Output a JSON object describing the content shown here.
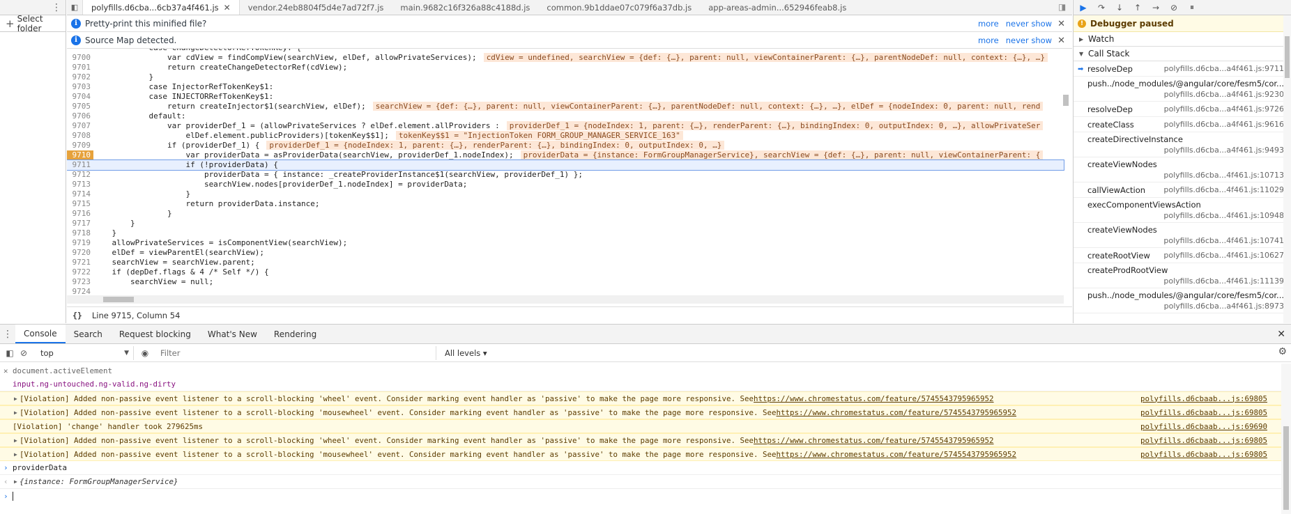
{
  "left_panel": {
    "select_folder_label": "Select folder"
  },
  "file_tabs": [
    {
      "label": "polyfills.d6cba...6cb37a4f461.js",
      "active": true
    },
    {
      "label": "vendor.24eb8804f5d4e7ad72f7.js"
    },
    {
      "label": "main.9682c16f326a88c4188d.js"
    },
    {
      "label": "common.9b1ddae07c079f6a37db.js"
    },
    {
      "label": "app-areas-admin...652946feab8.js"
    }
  ],
  "infobars": {
    "pretty_print": {
      "text": "Pretty-print this minified file?",
      "more": "more",
      "never": "never show"
    },
    "source_map": {
      "text": "Source Map detected.",
      "more": "more",
      "never": "never show"
    }
  },
  "code_lines": [
    {
      "n": "",
      "text": "            case ChangeDetectorRefTokenKey: {",
      "val": ""
    },
    {
      "n": "9700",
      "text": "                var cdView = findCompView(searchView, elDef, allowPrivateServices);",
      "val": "cdView = undefined, searchView = {def: {…}, parent: null, viewContainerParent: {…}, parentNodeDef: null, context: {…}, …}"
    },
    {
      "n": "9701",
      "text": "                return createChangeDetectorRef(cdView);",
      "val": ""
    },
    {
      "n": "9702",
      "text": "            }",
      "val": ""
    },
    {
      "n": "9703",
      "text": "            case InjectorRefTokenKey$1:",
      "val": ""
    },
    {
      "n": "9704",
      "text": "            case INJECTORRefTokenKey$1:",
      "val": ""
    },
    {
      "n": "9705",
      "text": "                return createInjector$1(searchView, elDef);",
      "val": "searchView = {def: {…}, parent: null, viewContainerParent: {…}, parentNodeDef: null, context: {…}, …}, elDef = {nodeIndex: 0, parent: null, rend"
    },
    {
      "n": "9706",
      "text": "            default:",
      "val": ""
    },
    {
      "n": "9707",
      "text": "                var providerDef_1 = (allowPrivateServices ? elDef.element.allProviders :",
      "val": "providerDef_1 = {nodeIndex: 1, parent: {…}, renderParent: {…}, bindingIndex: 0, outputIndex: 0, …}, allowPrivateSer"
    },
    {
      "n": "9708",
      "text": "                    elDef.element.publicProviders)[tokenKey$$1];",
      "val": "tokenKey$$1 = \"InjectionToken FORM_GROUP_MANAGER_SERVICE_163\""
    },
    {
      "n": "9709",
      "text": "                if (providerDef_1) {",
      "val": "providerDef_1 = {nodeIndex: 1, parent: {…}, renderParent: {…}, bindingIndex: 0, outputIndex: 0, …}"
    },
    {
      "n": "9710",
      "text": "                    var providerData = asProviderData(searchView, providerDef_1.nodeIndex);",
      "val": "providerData = {instance: FormGroupManagerService}, searchView = {def: {…}, parent: null, viewContainerParent: {",
      "bp": true
    },
    {
      "n": "9711",
      "text": "                    if (!providerData) {",
      "val": "",
      "current": true
    },
    {
      "n": "9712",
      "text": "                        providerData = { instance: _createProviderInstance$1(searchView, providerDef_1) };",
      "val": ""
    },
    {
      "n": "9713",
      "text": "                        searchView.nodes[providerDef_1.nodeIndex] = providerData;",
      "val": ""
    },
    {
      "n": "9714",
      "text": "                    }",
      "val": ""
    },
    {
      "n": "9715",
      "text": "                    return providerData.instance;",
      "val": ""
    },
    {
      "n": "9716",
      "text": "                }",
      "val": ""
    },
    {
      "n": "9717",
      "text": "        }",
      "val": ""
    },
    {
      "n": "9718",
      "text": "    }",
      "val": ""
    },
    {
      "n": "9719",
      "text": "    allowPrivateServices = isComponentView(searchView);",
      "val": ""
    },
    {
      "n": "9720",
      "text": "    elDef = viewParentEl(searchView);",
      "val": ""
    },
    {
      "n": "9721",
      "text": "    searchView = searchView.parent;",
      "val": ""
    },
    {
      "n": "9722",
      "text": "    if (depDef.flags & 4 /* Self */) {",
      "val": ""
    },
    {
      "n": "9723",
      "text": "        searchView = null;",
      "val": ""
    },
    {
      "n": "9724",
      "text": "",
      "val": ""
    }
  ],
  "status_bar": {
    "braces": "{}",
    "position": "Line 9715, Column 54"
  },
  "debugger": {
    "paused": "Debugger paused",
    "watch": "Watch",
    "call_stack": "Call Stack",
    "frames": [
      {
        "name": "resolveDep",
        "loc": "polyfills.d6cba...a4f461.js:9711",
        "current": true
      },
      {
        "name": "push../node_modules/@angular/core/fesm5/cor...",
        "loc": "polyfills.d6cba...a4f461.js:9230",
        "two": true
      },
      {
        "name": "resolveDep",
        "loc": "polyfills.d6cba...a4f461.js:9726"
      },
      {
        "name": "createClass",
        "loc": "polyfills.d6cba...a4f461.js:9616"
      },
      {
        "name": "createDirectiveInstance",
        "loc": "polyfills.d6cba...a4f461.js:9493",
        "two": true
      },
      {
        "name": "createViewNodes",
        "loc": "polyfills.d6cba...4f461.js:10713",
        "two": true
      },
      {
        "name": "callViewAction",
        "loc": "polyfills.d6cba...4f461.js:11029"
      },
      {
        "name": "execComponentViewsAction",
        "loc": "polyfills.d6cba...4f461.js:10948",
        "two": true
      },
      {
        "name": "createViewNodes",
        "loc": "polyfills.d6cba...4f461.js:10741",
        "two": true
      },
      {
        "name": "createRootView",
        "loc": "polyfills.d6cba...4f461.js:10627"
      },
      {
        "name": "createProdRootView",
        "loc": "polyfills.d6cba...4f461.js:11139",
        "two": true
      },
      {
        "name": "push../node_modules/@angular/core/fesm5/cor...",
        "loc": "polyfills.d6cba...a4f461.js:8973",
        "two": true
      }
    ]
  },
  "drawer": {
    "tabs": [
      "Console",
      "Search",
      "Request blocking",
      "What's New",
      "Rendering"
    ],
    "context": "top",
    "filter_placeholder": "Filter",
    "levels": "All levels ▾"
  },
  "console": {
    "live_expr": "document.activeElement",
    "live_result": "input.ng-untouched.ng-valid.ng-dirty",
    "messages": [
      {
        "text": "[Violation] Added non-passive event listener to a scroll-blocking 'wheel' event. Consider marking event handler as 'passive' to make the page more responsive. See ",
        "link": "https://www.chromestatus.com/feature/5745543795965952",
        "src": "polyfills.d6cbaab...js:69805",
        "tri": true
      },
      {
        "text": "[Violation] Added non-passive event listener to a scroll-blocking 'mousewheel' event. Consider marking event handler as 'passive' to make the page more responsive. See ",
        "link": "https://www.chromestatus.com/feature/5745543795965952",
        "src": "polyfills.d6cbaab...js:69805",
        "tri": true
      },
      {
        "text": "[Violation] 'change' handler took 279625ms",
        "link": "",
        "src": "polyfills.d6cbaab...js:69690",
        "tri": false
      },
      {
        "text": "[Violation] Added non-passive event listener to a scroll-blocking 'wheel' event. Consider marking event handler as 'passive' to make the page more responsive. See ",
        "link": "https://www.chromestatus.com/feature/5745543795965952",
        "src": "polyfills.d6cbaab...js:69805",
        "tri": true
      },
      {
        "text": "[Violation] Added non-passive event listener to a scroll-blocking 'mousewheel' event. Consider marking event handler as 'passive' to make the page more responsive. See ",
        "link": "https://www.chromestatus.com/feature/5745543795965952",
        "src": "polyfills.d6cbaab...js:69805",
        "tri": true
      }
    ],
    "input": "providerData",
    "result": "{instance: FormGroupManagerService}"
  }
}
